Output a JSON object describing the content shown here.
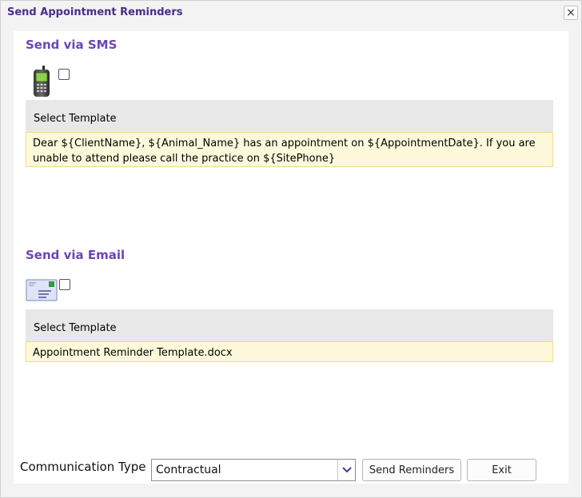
{
  "dialog": {
    "title": "Send Appointment Reminders",
    "close_label": "×"
  },
  "sms": {
    "heading": "Send via SMS",
    "checked": false,
    "template_header": "Select Template",
    "template_text": "Dear ${ClientName}, ${Animal_Name} has an appointment on ${AppointmentDate}. If you are unable to attend please call the practice on ${SitePhone}"
  },
  "email": {
    "heading": "Send via Email",
    "checked": false,
    "template_header": "Select Template",
    "template_text": "Appointment Reminder Template.docx"
  },
  "footer": {
    "communication_type_label": "Communication Type",
    "communication_type_value": "Contractual",
    "send_button": "Send Reminders",
    "exit_button": "Exit"
  },
  "colors": {
    "title": "#4b2d8a",
    "section_heading": "#6a45b8",
    "template_highlight": "#fff9db",
    "template_header_bg": "#e8e8e8"
  }
}
